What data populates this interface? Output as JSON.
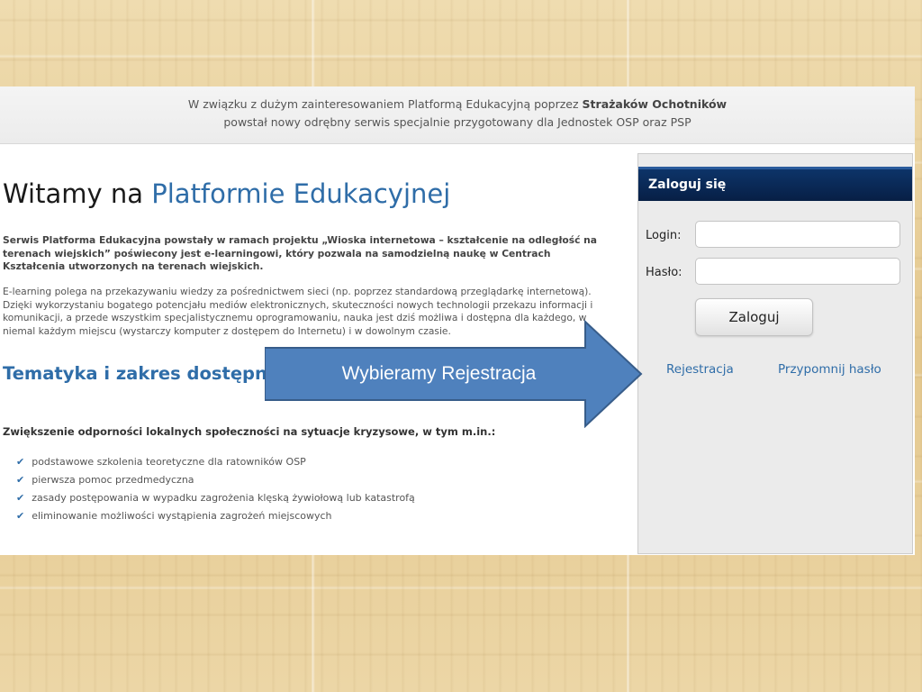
{
  "banner": {
    "line1_prefix": "W związku z dużym zainteresowaniem Platformą Edukacyjną poprzez ",
    "line1_bold": "Strażaków Ochotników",
    "line2": "powstał nowy odrębny serwis specjalnie przygotowany dla Jednostek OSP oraz PSP"
  },
  "main": {
    "title_prefix": "Witamy na ",
    "title_highlight": "Platformie Edukacyjnej",
    "intro_bold": "Serwis Platforma Edukacyjna powstały w ramach projektu „Wioska internetowa – kształcenie na odległość na terenach wiejskich” poświecony jest e-learningowi, który pozwala na samodzielną naukę w Centrach Kształcenia utworzonych na terenach wiejskich.",
    "intro_text": "E-learning polega na przekazywaniu wiedzy za pośrednictwem sieci (np. poprzez standardową przeglądarkę internetową). Dzięki wykorzystaniu bogatego potencjału mediów elektronicznych, skuteczności nowych technologii przekazu informacji i komunikacji, a przede wszystkim specjalistycznemu oprogramowaniu, nauka jest dziś możliwa i dostępna dla każdego, w niemal każdym miejscu (wystarczy komputer z dostępem do Internetu) i w dowolnym czasie.",
    "section_title": "Tematyka i zakres dostępnych szkoleń",
    "subsection_title": "Zwiększenie odporności lokalnych społeczności na sytuacje kryzysowe, w tym m.in.:",
    "topics": [
      "podstawowe szkolenia teoretyczne dla ratowników OSP",
      "pierwsza pomoc przedmedyczna",
      "zasady postępowania w wypadku zagrożenia klęską żywiołową lub katastrofą",
      "eliminowanie możliwości wystąpienia zagrożeń miejscowych"
    ]
  },
  "login": {
    "header": "Zaloguj się",
    "login_label": "Login:",
    "login_value": "",
    "password_label": "Hasło:",
    "password_value": "",
    "submit_label": "Zaloguj",
    "register_link": "Rejestracja",
    "remind_link": "Przypomnij hasło"
  },
  "callout": {
    "text": "Wybieramy Rejestracja",
    "fill_color": "#4f81bd",
    "stroke_color": "#385d8a"
  },
  "colors": {
    "accent_blue": "#2f6da8",
    "header_navy": "#0d3469"
  }
}
